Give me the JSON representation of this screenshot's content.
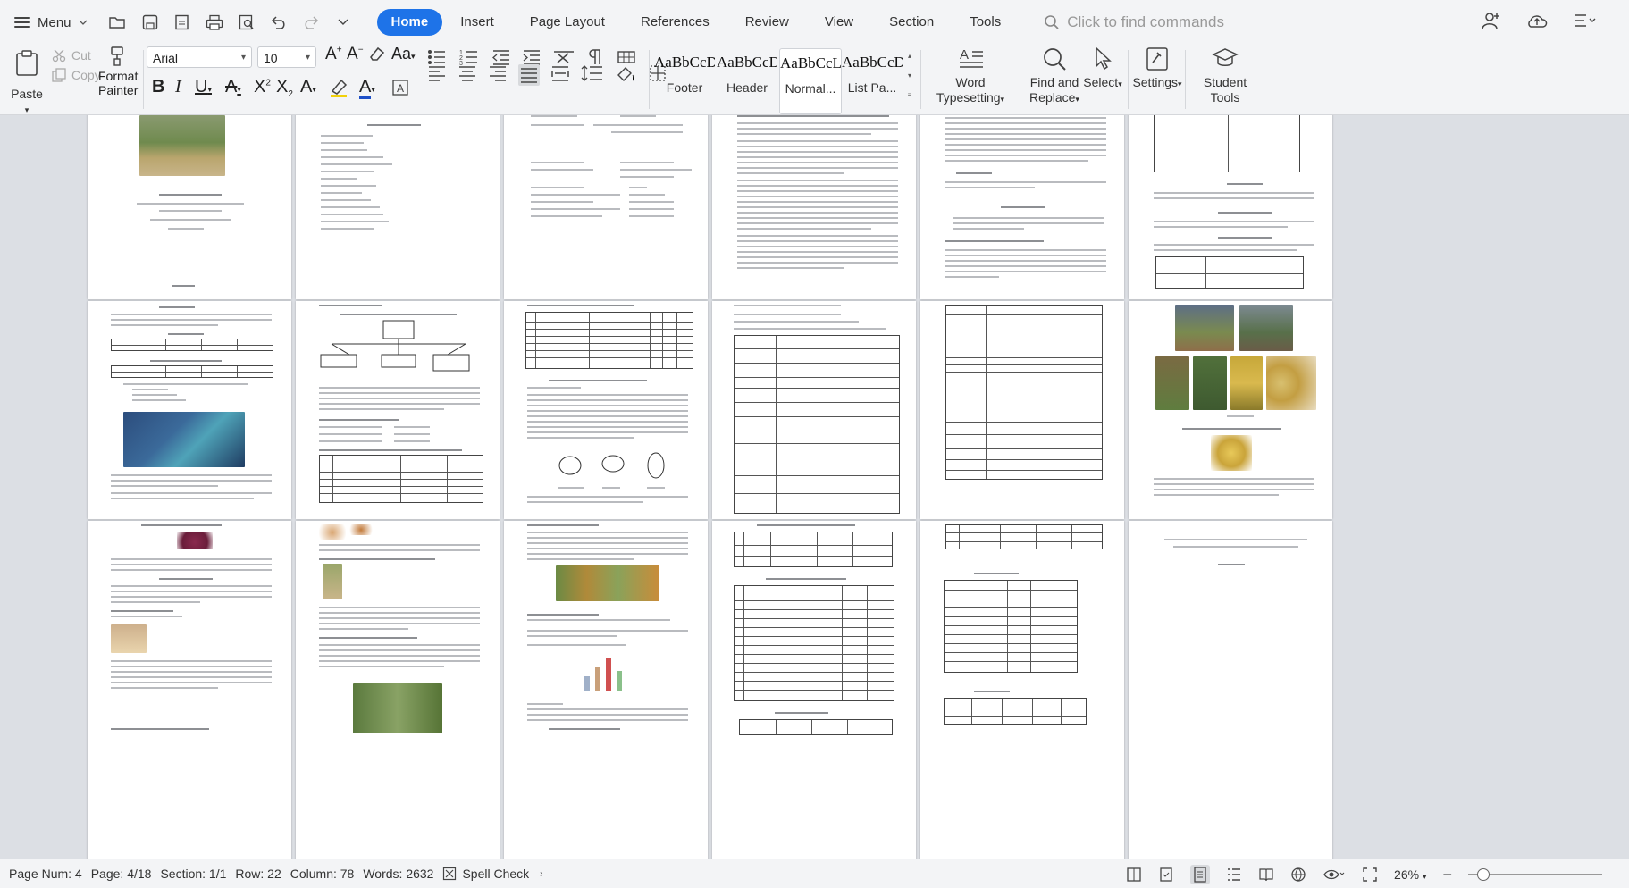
{
  "menubar": {
    "menu_label": "Menu",
    "tabs": [
      {
        "label": "Home",
        "active": true
      },
      {
        "label": "Insert"
      },
      {
        "label": "Page Layout"
      },
      {
        "label": "References"
      },
      {
        "label": "Review"
      },
      {
        "label": "View"
      },
      {
        "label": "Section"
      },
      {
        "label": "Tools"
      }
    ],
    "find_placeholder": "Click to find commands"
  },
  "ribbon": {
    "paste": "Paste",
    "cut": "Cut",
    "copy": "Copy",
    "format_painter": [
      "Format",
      "Painter"
    ],
    "font_name": "Arial",
    "font_size": "10",
    "styles": [
      {
        "sample": "AaBbCcDd",
        "name": "Footer"
      },
      {
        "sample": "AaBbCcDd",
        "name": "Header"
      },
      {
        "sample": "AaBbCcL",
        "name": "Normal..."
      },
      {
        "sample": "AaBbCcD",
        "name": "List Pa..."
      }
    ],
    "word_typesetting": "Word Typesetting",
    "find_replace": [
      "Find and",
      "Replace"
    ],
    "select": "Select",
    "settings": "Settings",
    "student_tools": "Student Tools"
  },
  "status": {
    "page_num": "Page Num: 4",
    "page": "Page: 4/18",
    "section": "Section: 1/1",
    "row": "Row: 22",
    "column": "Column: 78",
    "words": "Words: 2632",
    "spell_check": "Spell Check",
    "zoom": "26%"
  },
  "colors": {
    "accent": "#1e73e8",
    "font_color": "#1e50c8",
    "highlight": "#f2d10a"
  }
}
